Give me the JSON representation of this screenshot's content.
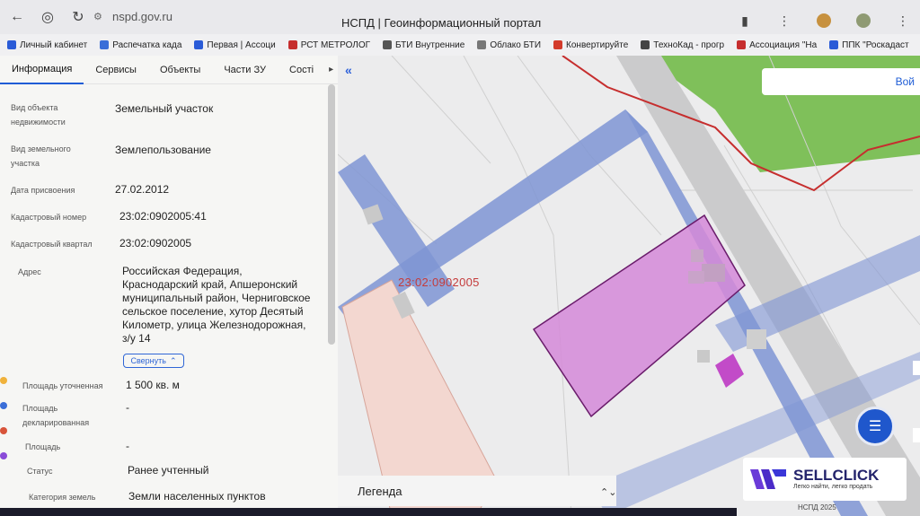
{
  "browser": {
    "url": "nspd.gov.ru",
    "page_title": "НСПД | Геоинформационный портал"
  },
  "bookmarks": [
    {
      "label": "Личный кабинет",
      "color": "#2a5bd7"
    },
    {
      "label": "Распечатка када",
      "color": "#3a6ed8"
    },
    {
      "label": "Первая | Ассоци",
      "color": "#2a5bd7"
    },
    {
      "label": "РСТ МЕТРОЛОГ",
      "color": "#c62e2e"
    },
    {
      "label": "БТИ Внутренние",
      "color": "#555555"
    },
    {
      "label": "Облако БТИ",
      "color": "#777777"
    },
    {
      "label": "Конвертируйте",
      "color": "#d33a2a"
    },
    {
      "label": "ТехноКад - прогр",
      "color": "#444444"
    },
    {
      "label": "Ассоциация \"На",
      "color": "#c62e2e"
    },
    {
      "label": "ППК \"Роскадаст",
      "color": "#2a5bd7"
    }
  ],
  "tabs": [
    {
      "label": "Информация",
      "active": true
    },
    {
      "label": "Сервисы",
      "active": false
    },
    {
      "label": "Объекты",
      "active": false
    },
    {
      "label": "Части ЗУ",
      "active": false
    },
    {
      "label": "Сості",
      "active": false
    }
  ],
  "info": {
    "object_type_label": "Вид объекта недвижимости",
    "object_type_value": "Земельный участок",
    "parcel_type_label": "Вид земельного участка",
    "parcel_type_value": "Землепользование",
    "date_label": "Дата присвоения",
    "date_value": "27.02.2012",
    "cad_number_label": "Кадастровый номер",
    "cad_number_value": "23:02:0902005:41",
    "cad_quarter_label": "Кадастровый квартал",
    "cad_quarter_value": "23:02:0902005",
    "address_label": "Адрес",
    "address_value": "Российская Федерация, Краснодарский край, Апшеронский муниципальный район, Черниговское сельское поселение, хутор Десятый Километр, улица Железнодорожная, з/у 14",
    "collapse_label": "Свернуть",
    "area_precise_label": "Площадь уточненная",
    "area_precise_value": "1 500 кв. м",
    "area_declared_label": "Площадь декларированная",
    "area_declared_value": "-",
    "area_label": "Площадь",
    "area_value": "-",
    "status_label": "Статус",
    "status_value": "Ранее учтенный",
    "land_category_label": "Категория земель",
    "land_category_value": "Земли населенных пунктов"
  },
  "map": {
    "search_label": "Вой",
    "quarter_label": "23:02:0902005",
    "legend_label": "Легенда",
    "footer": "НСПД 2025",
    "scale": "10 м"
  },
  "watermark": {
    "title": "SELLCLICK",
    "subtitle": "Легко найти, легко продать"
  },
  "colors": {
    "accent": "#1f5dd6",
    "parcel": "#d58ad8",
    "road": "#7f95d4",
    "boundary": "#c62e2e"
  }
}
